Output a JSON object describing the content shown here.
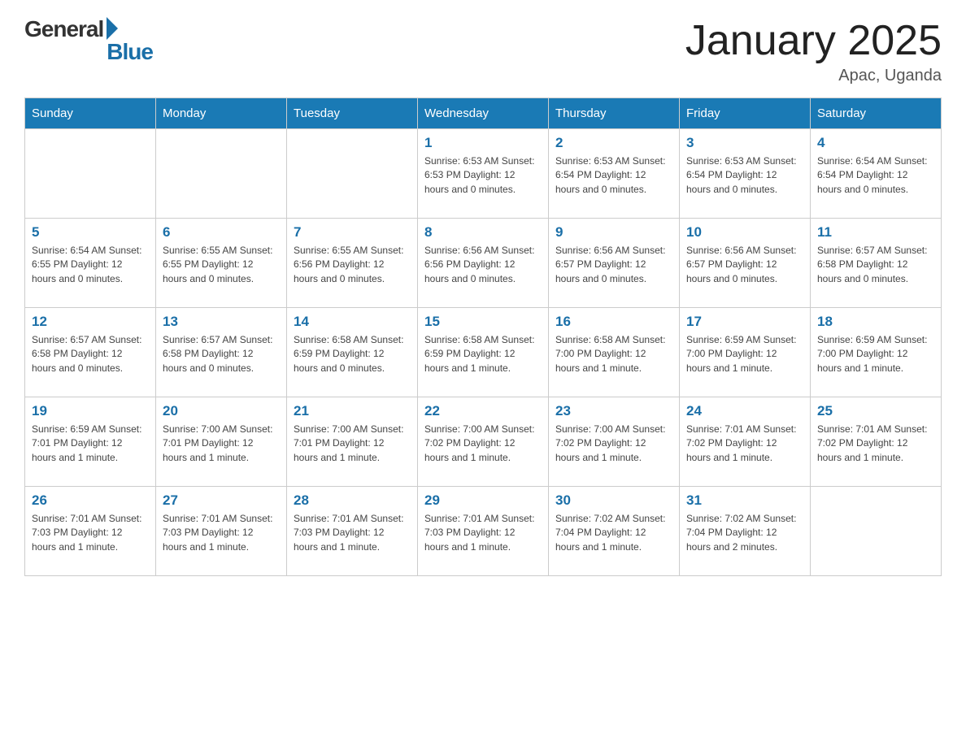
{
  "header": {
    "logo": {
      "general": "General",
      "blue": "Blue"
    },
    "title": "January 2025",
    "location": "Apac, Uganda"
  },
  "calendar": {
    "days_of_week": [
      "Sunday",
      "Monday",
      "Tuesday",
      "Wednesday",
      "Thursday",
      "Friday",
      "Saturday"
    ],
    "weeks": [
      [
        {
          "day": "",
          "info": ""
        },
        {
          "day": "",
          "info": ""
        },
        {
          "day": "",
          "info": ""
        },
        {
          "day": "1",
          "info": "Sunrise: 6:53 AM\nSunset: 6:53 PM\nDaylight: 12 hours\nand 0 minutes."
        },
        {
          "day": "2",
          "info": "Sunrise: 6:53 AM\nSunset: 6:54 PM\nDaylight: 12 hours\nand 0 minutes."
        },
        {
          "day": "3",
          "info": "Sunrise: 6:53 AM\nSunset: 6:54 PM\nDaylight: 12 hours\nand 0 minutes."
        },
        {
          "day": "4",
          "info": "Sunrise: 6:54 AM\nSunset: 6:54 PM\nDaylight: 12 hours\nand 0 minutes."
        }
      ],
      [
        {
          "day": "5",
          "info": "Sunrise: 6:54 AM\nSunset: 6:55 PM\nDaylight: 12 hours\nand 0 minutes."
        },
        {
          "day": "6",
          "info": "Sunrise: 6:55 AM\nSunset: 6:55 PM\nDaylight: 12 hours\nand 0 minutes."
        },
        {
          "day": "7",
          "info": "Sunrise: 6:55 AM\nSunset: 6:56 PM\nDaylight: 12 hours\nand 0 minutes."
        },
        {
          "day": "8",
          "info": "Sunrise: 6:56 AM\nSunset: 6:56 PM\nDaylight: 12 hours\nand 0 minutes."
        },
        {
          "day": "9",
          "info": "Sunrise: 6:56 AM\nSunset: 6:57 PM\nDaylight: 12 hours\nand 0 minutes."
        },
        {
          "day": "10",
          "info": "Sunrise: 6:56 AM\nSunset: 6:57 PM\nDaylight: 12 hours\nand 0 minutes."
        },
        {
          "day": "11",
          "info": "Sunrise: 6:57 AM\nSunset: 6:58 PM\nDaylight: 12 hours\nand 0 minutes."
        }
      ],
      [
        {
          "day": "12",
          "info": "Sunrise: 6:57 AM\nSunset: 6:58 PM\nDaylight: 12 hours\nand 0 minutes."
        },
        {
          "day": "13",
          "info": "Sunrise: 6:57 AM\nSunset: 6:58 PM\nDaylight: 12 hours\nand 0 minutes."
        },
        {
          "day": "14",
          "info": "Sunrise: 6:58 AM\nSunset: 6:59 PM\nDaylight: 12 hours\nand 0 minutes."
        },
        {
          "day": "15",
          "info": "Sunrise: 6:58 AM\nSunset: 6:59 PM\nDaylight: 12 hours\nand 1 minute."
        },
        {
          "day": "16",
          "info": "Sunrise: 6:58 AM\nSunset: 7:00 PM\nDaylight: 12 hours\nand 1 minute."
        },
        {
          "day": "17",
          "info": "Sunrise: 6:59 AM\nSunset: 7:00 PM\nDaylight: 12 hours\nand 1 minute."
        },
        {
          "day": "18",
          "info": "Sunrise: 6:59 AM\nSunset: 7:00 PM\nDaylight: 12 hours\nand 1 minute."
        }
      ],
      [
        {
          "day": "19",
          "info": "Sunrise: 6:59 AM\nSunset: 7:01 PM\nDaylight: 12 hours\nand 1 minute."
        },
        {
          "day": "20",
          "info": "Sunrise: 7:00 AM\nSunset: 7:01 PM\nDaylight: 12 hours\nand 1 minute."
        },
        {
          "day": "21",
          "info": "Sunrise: 7:00 AM\nSunset: 7:01 PM\nDaylight: 12 hours\nand 1 minute."
        },
        {
          "day": "22",
          "info": "Sunrise: 7:00 AM\nSunset: 7:02 PM\nDaylight: 12 hours\nand 1 minute."
        },
        {
          "day": "23",
          "info": "Sunrise: 7:00 AM\nSunset: 7:02 PM\nDaylight: 12 hours\nand 1 minute."
        },
        {
          "day": "24",
          "info": "Sunrise: 7:01 AM\nSunset: 7:02 PM\nDaylight: 12 hours\nand 1 minute."
        },
        {
          "day": "25",
          "info": "Sunrise: 7:01 AM\nSunset: 7:02 PM\nDaylight: 12 hours\nand 1 minute."
        }
      ],
      [
        {
          "day": "26",
          "info": "Sunrise: 7:01 AM\nSunset: 7:03 PM\nDaylight: 12 hours\nand 1 minute."
        },
        {
          "day": "27",
          "info": "Sunrise: 7:01 AM\nSunset: 7:03 PM\nDaylight: 12 hours\nand 1 minute."
        },
        {
          "day": "28",
          "info": "Sunrise: 7:01 AM\nSunset: 7:03 PM\nDaylight: 12 hours\nand 1 minute."
        },
        {
          "day": "29",
          "info": "Sunrise: 7:01 AM\nSunset: 7:03 PM\nDaylight: 12 hours\nand 1 minute."
        },
        {
          "day": "30",
          "info": "Sunrise: 7:02 AM\nSunset: 7:04 PM\nDaylight: 12 hours\nand 1 minute."
        },
        {
          "day": "31",
          "info": "Sunrise: 7:02 AM\nSunset: 7:04 PM\nDaylight: 12 hours\nand 2 minutes."
        },
        {
          "day": "",
          "info": ""
        }
      ]
    ]
  }
}
